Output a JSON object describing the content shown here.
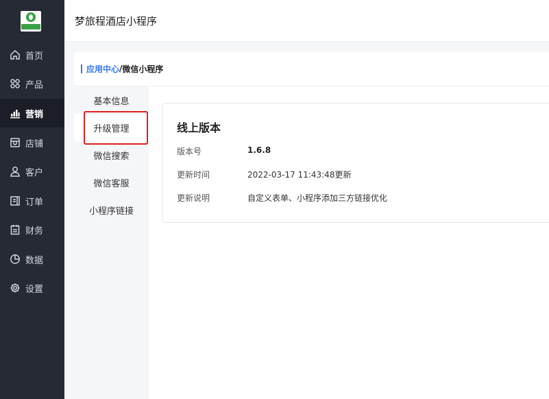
{
  "app": {
    "title": "梦旅程酒店小程序"
  },
  "sidebar": {
    "items": [
      {
        "label": "首页",
        "icon": "home-icon"
      },
      {
        "label": "产品",
        "icon": "grid-icon"
      },
      {
        "label": "营销",
        "icon": "chart-icon",
        "active": true
      },
      {
        "label": "店铺",
        "icon": "store-icon"
      },
      {
        "label": "客户",
        "icon": "user-icon"
      },
      {
        "label": "订单",
        "icon": "order-icon"
      },
      {
        "label": "财务",
        "icon": "finance-icon"
      },
      {
        "label": "数据",
        "icon": "pie-icon"
      },
      {
        "label": "设置",
        "icon": "gear-icon"
      }
    ]
  },
  "breadcrumb": {
    "parent": "应用中心",
    "separator": "/",
    "current": "微信小程序"
  },
  "subnav": {
    "items": [
      {
        "label": "基本信息"
      },
      {
        "label": "升级管理",
        "active": true
      },
      {
        "label": "微信搜索"
      },
      {
        "label": "微信客服"
      },
      {
        "label": "小程序链接"
      }
    ]
  },
  "version": {
    "title": "线上版本",
    "rows": [
      {
        "label": "版本号",
        "value": "1.6.8"
      },
      {
        "label": "更新时间",
        "value": "2022-03-17 11:43:48更新"
      },
      {
        "label": "更新说明",
        "value": "自定义表单、小程序添加三方链接优化"
      }
    ]
  },
  "colors": {
    "sidebar_bg": "#262a35",
    "accent": "#3377ff",
    "highlight": "#e02020"
  }
}
